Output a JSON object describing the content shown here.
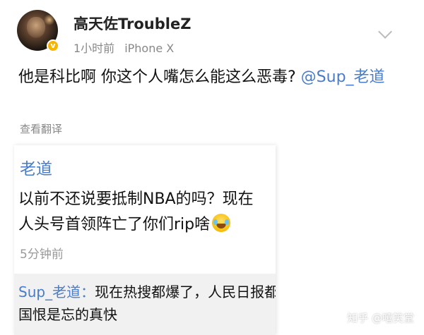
{
  "post": {
    "username": "高天佐TroubleZ",
    "time": "1小时前",
    "device": "iPhone X",
    "text": "他是科比啊 你这个人嘴怎么能这么恶毒? ",
    "mention": "@Sup_老道",
    "translate_label": "查看翻译",
    "verified_badge": "v"
  },
  "embedded": {
    "name": "老道",
    "line1": "以前不还说要抵制NBA的吗？现在",
    "line2": "人头号首领阵亡了你们rip啥",
    "emoji": "tears-of-joy-emoji",
    "time": "5分钟前",
    "reply_name": "Sup_老道：",
    "reply_line1": "现在热搜都爆了，人民日报都在",
    "reply_line2": "国恨是忘的真快"
  },
  "watermark": "知乎 @嘻笑堂",
  "colors": {
    "mention": "#4a7cc8",
    "meta": "#888888",
    "badge": "#f7b500"
  }
}
